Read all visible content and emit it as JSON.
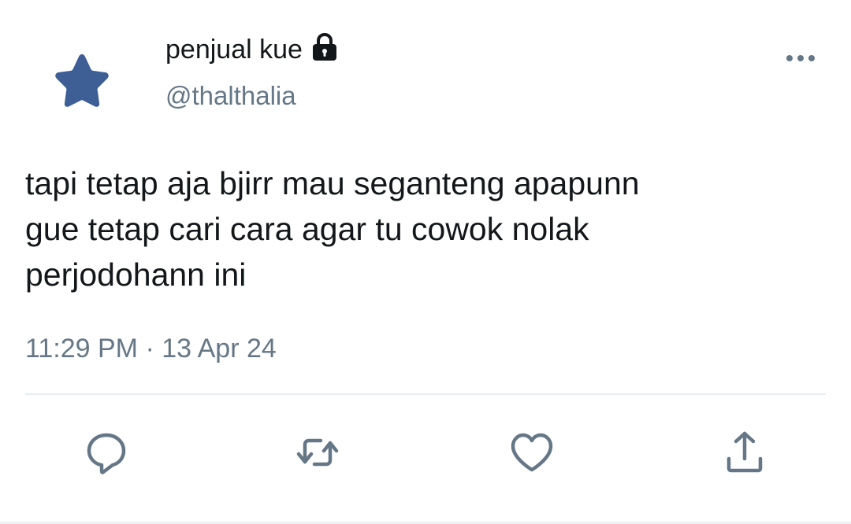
{
  "user": {
    "display_name": "penjual kue",
    "handle": "@thalthalia",
    "avatar_icon": "star-icon",
    "avatar_color": "#3d5f95",
    "protected_icon": "lock-icon"
  },
  "tweet": {
    "text": "tapi tetap aja bjirr mau seganteng apapunn\ngue tetap cari cara agar tu cowok nolak\nperjodohann ini",
    "timestamp": "11:29 PM · 13 Apr 24"
  },
  "menu": {
    "icon": "more-horizontal-icon"
  },
  "actions": [
    {
      "icon": "reply-icon"
    },
    {
      "icon": "retweet-icon"
    },
    {
      "icon": "like-icon"
    },
    {
      "icon": "share-icon"
    }
  ],
  "colors": {
    "text": "#14171a",
    "secondary": "#657786",
    "divider": "#e6ecf0"
  }
}
